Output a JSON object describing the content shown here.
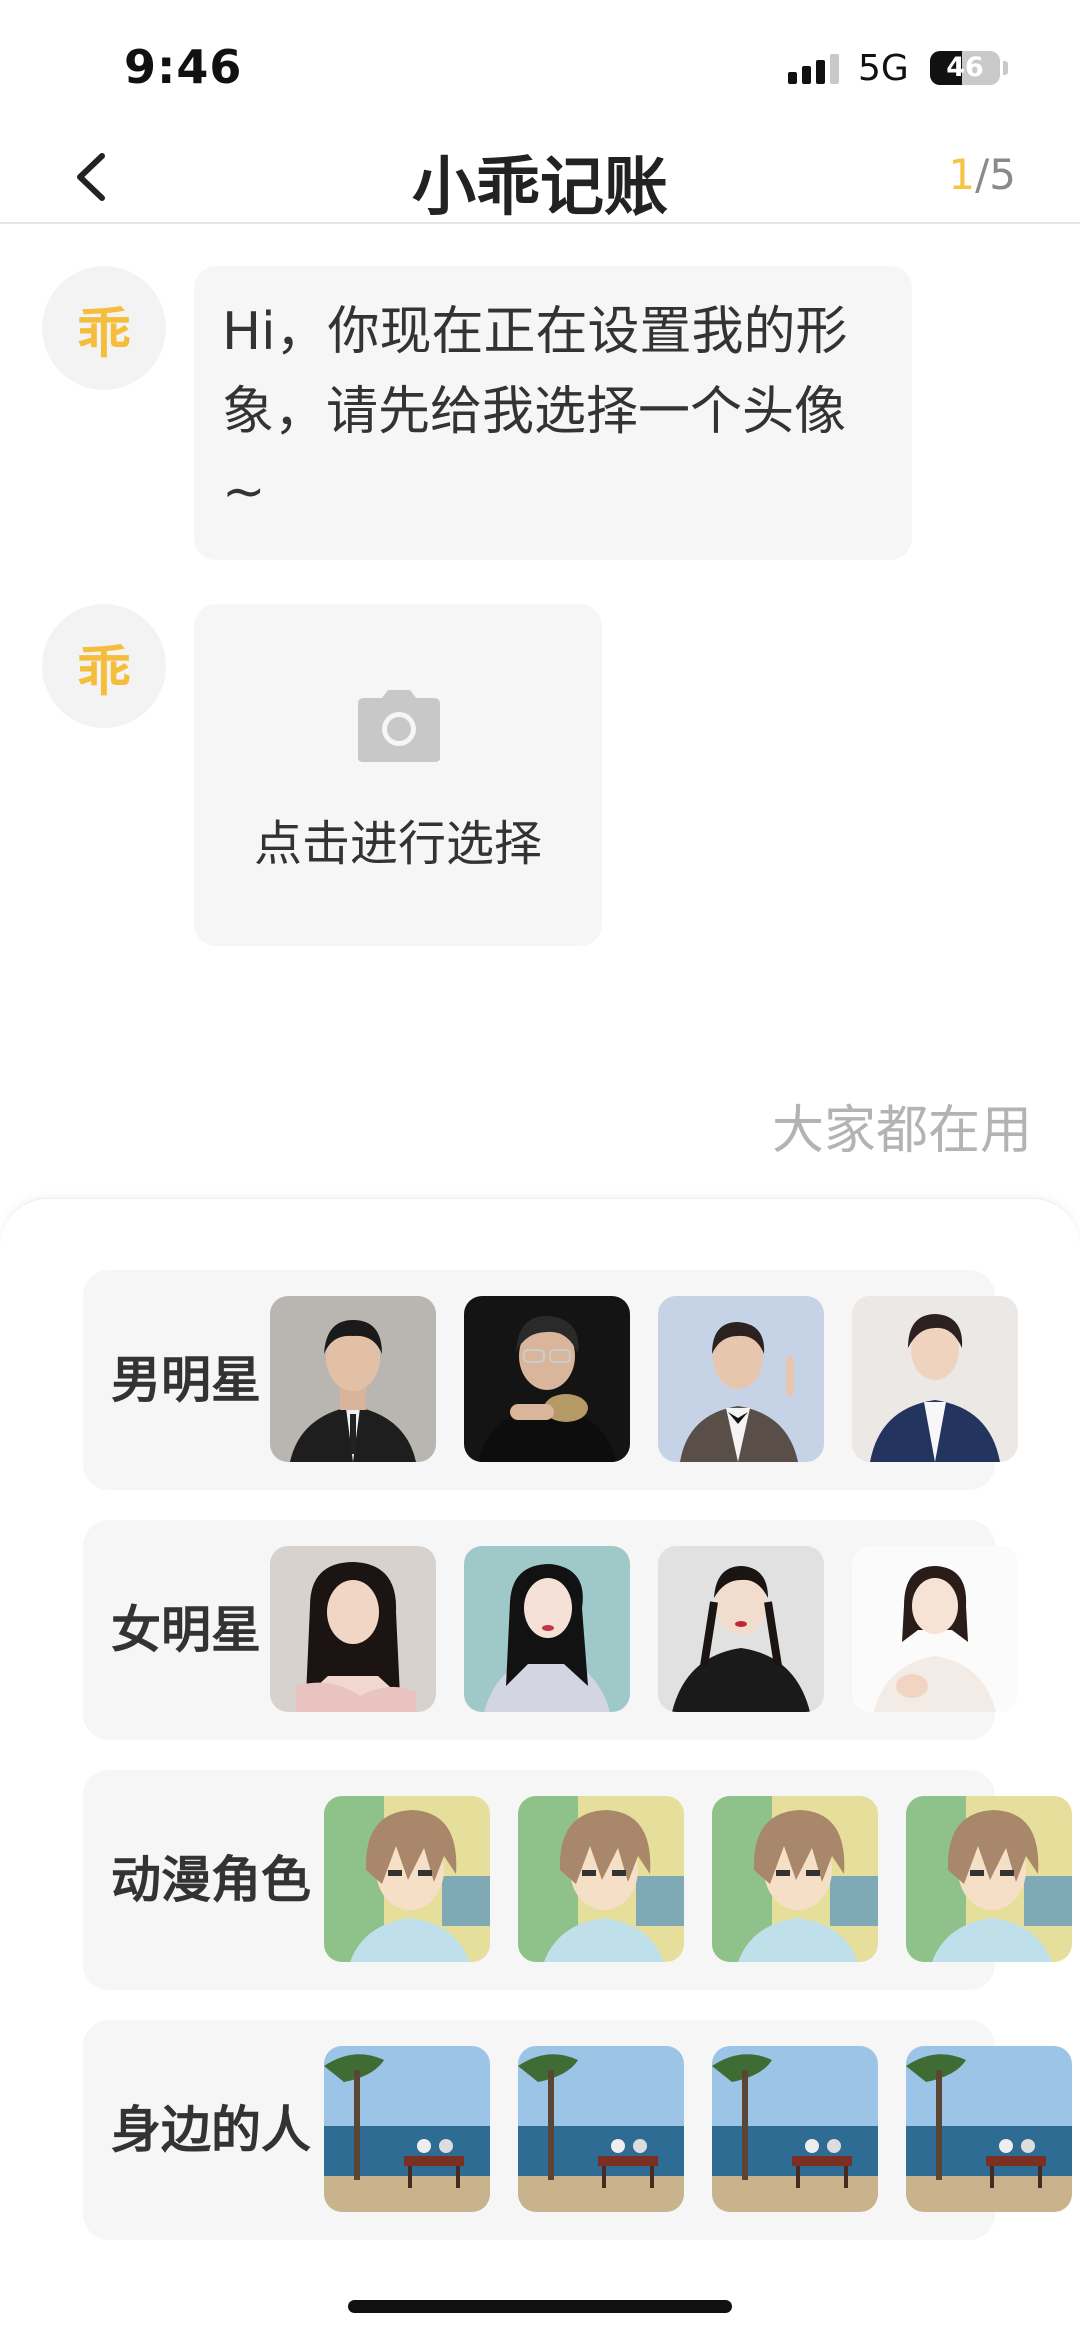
{
  "status_bar": {
    "time": "9:46",
    "network": "5G",
    "battery": "46",
    "battery_fraction": 0.46
  },
  "nav": {
    "title": "小乖记账",
    "page_current": "1",
    "page_separator": "/",
    "page_total": "5"
  },
  "chat": {
    "avatar_char": "乖",
    "greeting": "Hi，你现在正在设置我的形象，请先给我选择一个头像~",
    "picker_label": "点击进行选择",
    "picker_icon": "camera-icon"
  },
  "popular_label": "大家都在用",
  "categories": [
    {
      "label": "男明星",
      "thumb_kind": "male-star"
    },
    {
      "label": "女明星",
      "thumb_kind": "female-star"
    },
    {
      "label": "动漫角色",
      "thumb_kind": "anime-character"
    },
    {
      "label": "身边的人",
      "thumb_kind": "people-nearby"
    }
  ],
  "colors": {
    "accent": "#f5c542",
    "bubble": "#f6f6f6",
    "row_bg": "#f6f6f6"
  }
}
